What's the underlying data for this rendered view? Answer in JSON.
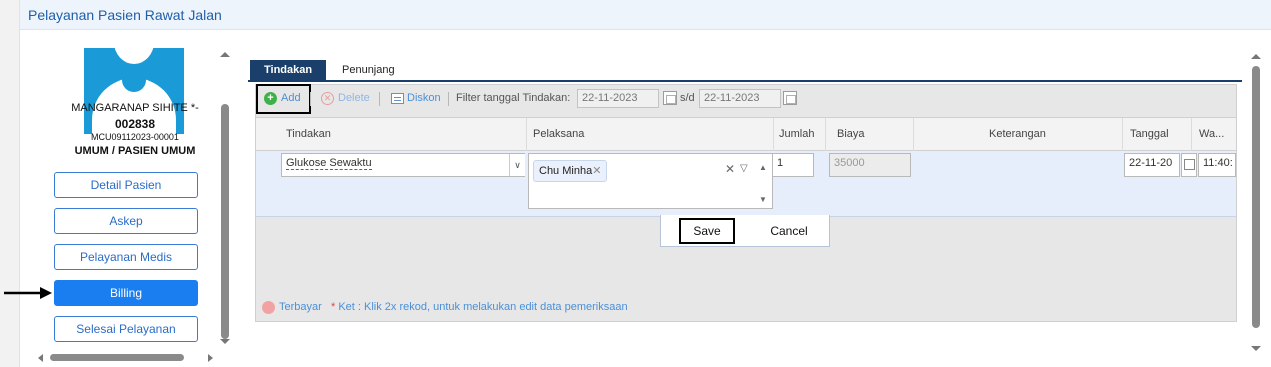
{
  "window": {
    "title": "Pelayanan Pasien Rawat Jalan"
  },
  "patient": {
    "name": "MANGARANAP SIHITE *-",
    "id": "002838",
    "mcu": "MCU09112023-00001",
    "category": "UMUM / PASIEN UMUM"
  },
  "nav": {
    "items": [
      {
        "label": "Detail Pasien"
      },
      {
        "label": "Askep"
      },
      {
        "label": "Pelayanan Medis"
      },
      {
        "label": "Billing",
        "active": true
      },
      {
        "label": "Selesai Pelayanan"
      }
    ]
  },
  "tabs": [
    {
      "label": "Tindakan",
      "active": true
    },
    {
      "label": "Penunjang",
      "active": false
    }
  ],
  "toolbar": {
    "add": "Add",
    "delete": "Delete",
    "discount": "Diskon",
    "filter_label": "Filter tanggal Tindakan:",
    "date_from": "22-11-2023",
    "sd_label": "s/d",
    "date_to": "22-11-2023"
  },
  "grid": {
    "columns": [
      "Tindakan",
      "Pelaksana",
      "Jumlah",
      "Biaya",
      "Keterangan",
      "Tanggal",
      "Wa..."
    ],
    "edit_row": {
      "tindakan": "Glukose Sewaktu",
      "pelaksana_chip": "Chu Minha",
      "jumlah": "1",
      "biaya": "35000",
      "keterangan": "",
      "tanggal": "22-11-20",
      "waktu": "11:40:"
    }
  },
  "editor": {
    "save": "Save",
    "cancel": "Cancel"
  },
  "footer": {
    "paid_label": "Terbayar",
    "note_star": "*",
    "note": "Ket : Klik 2x rekod, untuk melakukan edit data pemeriksaan"
  },
  "colors": {
    "accent": "#1a7ef0",
    "tab_active": "#1b3f6b",
    "link": "#4a90d9",
    "paid_dot": "#f2a2a2"
  }
}
